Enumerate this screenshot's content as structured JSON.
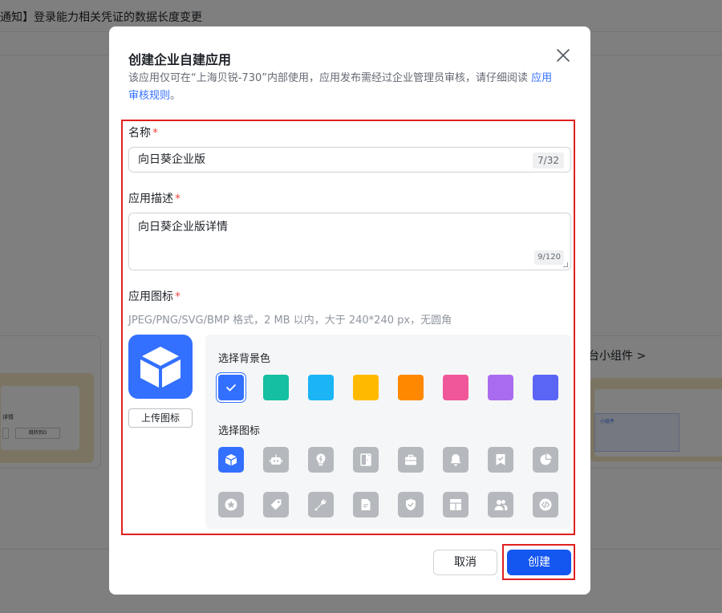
{
  "background": {
    "title": "通知】登录能力相关凭证的数据长度变更",
    "left_card_text": "详情",
    "left_card_btn": "跳转到D",
    "right_card_title": "台小组件 >",
    "right_card_block": "小组件"
  },
  "dialog": {
    "title": "创建企业自建应用",
    "desc_prefix": "该应用仅可在“上海贝锐-730”内部使用，应用发布需经过企业管理员审核，请仔细阅读",
    "desc_link": "应用审核规则",
    "desc_suffix": "。",
    "name_label": "名称",
    "required_mark": "*",
    "name_value": "向日葵企业版",
    "name_counter": "7/32",
    "desc_label": "应用描述",
    "desc_value": "向日葵企业版详情",
    "desc_counter": "9/120",
    "icon_label": "应用图标",
    "icon_hint": "JPEG/PNG/SVG/BMP 格式，2 MB 以内，大于 240*240 px，无圆角",
    "upload_label": "上传图标",
    "bg_color_label": "选择背景色",
    "icon_select_label": "选择图标",
    "cancel_label": "取消",
    "create_label": "创建"
  },
  "colors": {
    "accent": "#3370ff",
    "primary_button": "#1456f0",
    "highlight_frame": "#e02020",
    "swatches": [
      "#3370ff",
      "#14c0a0",
      "#1bb4f5",
      "#ffba00",
      "#ff8800",
      "#f0579a",
      "#a96cf0",
      "#5b65f5"
    ],
    "selected_swatch": 0
  },
  "icons": [
    "cube-icon",
    "robot-icon",
    "lightbulb-icon",
    "door-icon",
    "briefcase-icon",
    "bell-icon",
    "bookmark-check-icon",
    "pie-chart-icon",
    "star-icon",
    "tag-icon",
    "wrench-icon",
    "document-icon",
    "shield-check-icon",
    "layout-icon",
    "users-icon",
    "code-icon"
  ],
  "selected_icon": 0
}
